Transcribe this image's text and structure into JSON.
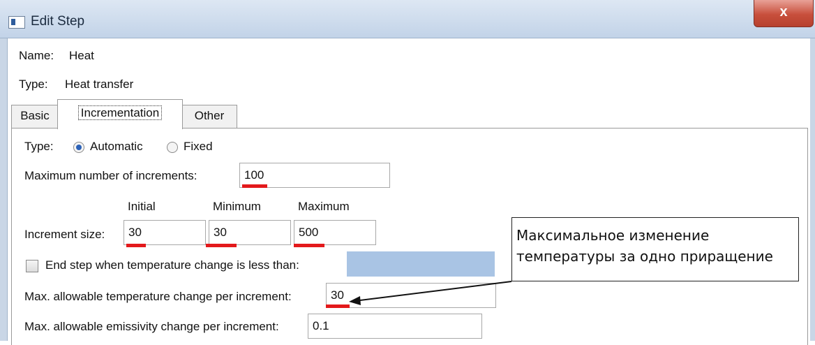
{
  "window": {
    "title": "Edit Step",
    "close_glyph": "x"
  },
  "step": {
    "name_label": "Name:",
    "name_value": "Heat",
    "type_label": "Type:",
    "type_value": "Heat transfer"
  },
  "tabs": [
    {
      "label": "Basic"
    },
    {
      "label": "Incrementation"
    },
    {
      "label": "Other"
    }
  ],
  "incrementation": {
    "type_label": "Type:",
    "automatic_label": "Automatic",
    "fixed_label": "Fixed",
    "max_increments_label": "Maximum number of increments:",
    "max_increments_value": "100",
    "col_initial": "Initial",
    "col_minimum": "Minimum",
    "col_maximum": "Maximum",
    "increment_size_label": "Increment size:",
    "initial_value": "30",
    "minimum_value": "30",
    "maximum_value": "500",
    "end_step_label": "End step when temperature change is less than:",
    "end_step_value": "",
    "max_temp_change_label": "Max. allowable temperature change per increment:",
    "max_temp_change_value": "30",
    "max_emissivity_label": "Max. allowable emissivity change per increment:",
    "max_emissivity_value": "0.1"
  },
  "annotation": {
    "line1": "Максимальное изменение",
    "line2": "температуры за одно приращение"
  },
  "colors": {
    "underline": "#e3191b",
    "radio_selected": "#2c62b8",
    "disabled_field": "#a9c4e4"
  }
}
